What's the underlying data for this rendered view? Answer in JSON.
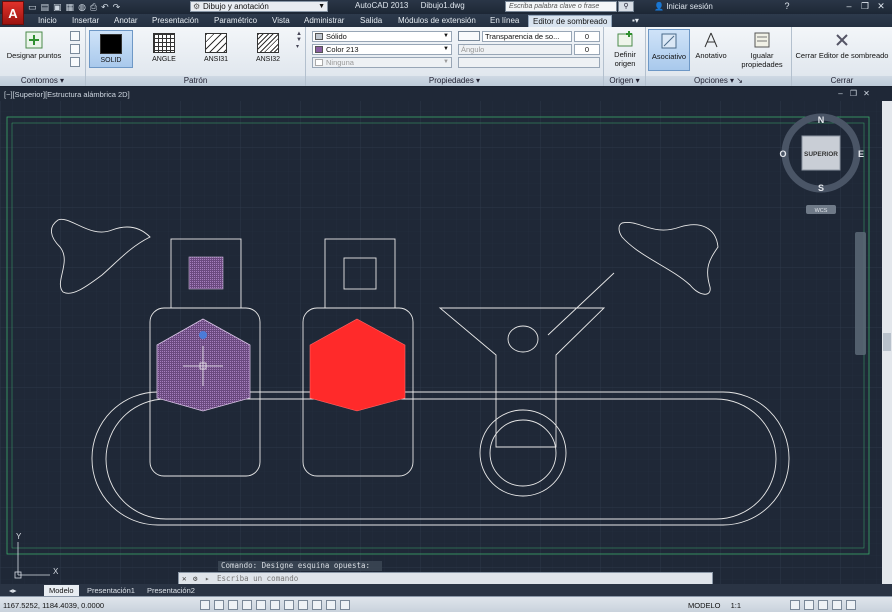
{
  "titlebar": {
    "logo": "A",
    "workspace": "Dibujo y anotación",
    "app_name": "AutoCAD 2013",
    "file_name": "Dibujo1.dwg",
    "search_placeholder": "Escriba palabra clave o frase",
    "sign_in": "Iniciar sesión",
    "help": "?"
  },
  "tabs": [
    "Inicio",
    "Insertar",
    "Anotar",
    "Presentación",
    "Paramétrico",
    "Vista",
    "Administrar",
    "Salida",
    "Módulos de extensión",
    "En línea",
    "Editor de sombreado"
  ],
  "ribbon": {
    "contornos": {
      "label": "Contornos",
      "designar_puntos": "Designar puntos"
    },
    "patron": {
      "label": "Patrón",
      "patterns": [
        "SOLID",
        "ANGLE",
        "ANSI31",
        "ANSI32"
      ]
    },
    "propiedades": {
      "label": "Propiedades",
      "type": "Sólido",
      "color": "Color 213",
      "background": "Ninguna",
      "transparency_label": "Transparencia de so...",
      "transparency_value": "0",
      "angle_label": "Ángulo",
      "angle_value": "0"
    },
    "origen": {
      "label": "Origen",
      "definir": "Definir origen"
    },
    "opciones": {
      "label": "Opciones",
      "asociativo": "Asociativo",
      "anotativo": "Anotativo",
      "igualar": "Igualar propiedades"
    },
    "cerrar": {
      "label": "Cerrar",
      "cerrar_editor": "Cerrar Editor de sombreado"
    }
  },
  "viewport": {
    "label": "[−][Superior][Estructura alámbrica 2D]",
    "viewcube": {
      "center": "SUPERIOR",
      "n": "N",
      "s": "S",
      "e": "E",
      "o": "O",
      "wcs": "WCS"
    },
    "ucs_x": "X",
    "ucs_y": "Y"
  },
  "command": {
    "history": "Comando: Designe esquina opuesta:",
    "placeholder": "Escriba un comando"
  },
  "layout_tabs": [
    "Modelo",
    "Presentación1",
    "Presentación2"
  ],
  "status": {
    "coords": "1167.5252, 1184.4039, 0.0000",
    "model": "MODELO",
    "scale": "1:1"
  },
  "colors": {
    "hatch_red": "#ff2a2a",
    "hatch_purple": "#8a5fa0",
    "line": "#e8e8e8",
    "grid": "#2c3646"
  }
}
